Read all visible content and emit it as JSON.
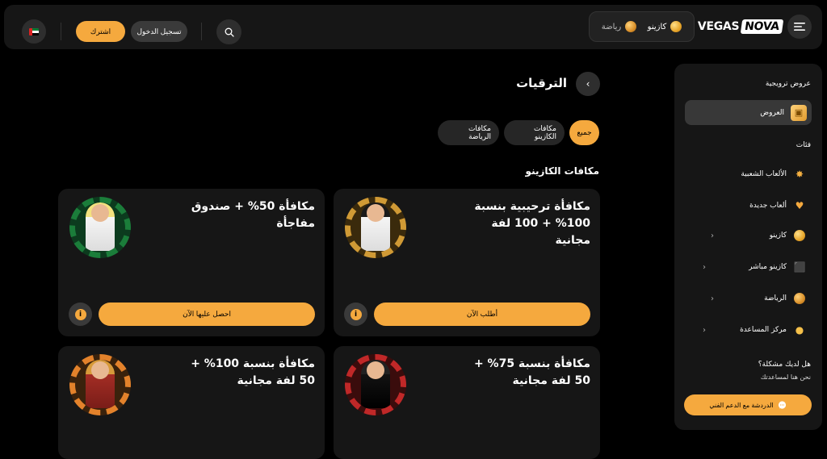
{
  "header": {
    "logo_left": "VEGAS",
    "logo_right": "NOVA",
    "categories": [
      {
        "label": "كازينو",
        "icon": "casino-chip-icon"
      },
      {
        "label": "رياضة",
        "icon": "sports-ball-icon"
      }
    ],
    "login_label": "تسجيل الدخول",
    "signup_label": "اشترك",
    "language_flag": "uae-flag-icon"
  },
  "sidebar": {
    "promos_heading": "عروض ترويجية",
    "active_item": {
      "label": "العروض",
      "icon": "gift-icon"
    },
    "categories_heading": "فئات",
    "items": [
      {
        "label": "الألعاب الشعبية",
        "icon": "star-icon",
        "has_chevron": false
      },
      {
        "label": "ألعاب جديدة",
        "icon": "heart-icon",
        "has_chevron": false
      },
      {
        "label": "كازينو",
        "icon": "casino-chip-icon",
        "has_chevron": true
      },
      {
        "label": "كازينو مباشر",
        "icon": "dice-icon",
        "has_chevron": true
      },
      {
        "label": "الرياضة",
        "icon": "sports-ball-icon",
        "has_chevron": true
      },
      {
        "label": "مركز المساعدة",
        "icon": "lightbulb-icon",
        "has_chevron": true
      }
    ],
    "help_question": "هل لديك مشكلة؟",
    "help_answer": "نحن هنا لمساعدتك",
    "chat_label": "الدردشة مع الدعم الفني"
  },
  "main": {
    "title": "الترقيات",
    "filters": [
      {
        "label": "جميع",
        "active": true
      },
      {
        "label": "مكافات الكازينو",
        "active": false
      },
      {
        "label": "مكافات الرياضة",
        "active": false
      }
    ],
    "section_title": "مكافات الكازينو",
    "cards": [
      {
        "title": "مكافأة ترحيبية بنسبة 100% + 100 لفة مجانية",
        "button": "أطلب الآن",
        "character": "elvis"
      },
      {
        "title": "مكافأة 50% + صندوق مفاجأة",
        "button": "احصل عليها الآن",
        "character": "marilyn"
      },
      {
        "title": "مكافأة بنسبة 75% + 50 لفة مجانية",
        "button": "",
        "character": "sinatra"
      },
      {
        "title": "مكافأة بنسبة 100% + 50 لفة مجانية",
        "button": "",
        "character": "caesar"
      }
    ]
  },
  "colors": {
    "accent": "#f5a93e",
    "background": "#000000",
    "panel": "#161616"
  }
}
